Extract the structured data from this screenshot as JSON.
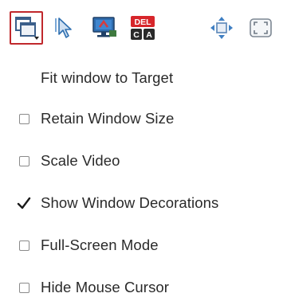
{
  "toolbar": {
    "buttons": [
      {
        "icon": "window-fit-icon",
        "active": true
      },
      {
        "icon": "mouse-pointer-icon",
        "active": false
      },
      {
        "icon": "remote-screen-icon",
        "active": false
      },
      {
        "icon": "ctrl-alt-del-icon",
        "active": false,
        "text_top": "DEL",
        "text_bottom_left": "C",
        "text_bottom_right": "A"
      },
      {
        "icon": "move-arrows-icon",
        "active": false
      },
      {
        "icon": "fullscreen-icon",
        "active": false
      }
    ],
    "accent_color": "#c0282c"
  },
  "menu": {
    "items": [
      {
        "label": "Fit window to Target",
        "type": "action"
      },
      {
        "label": "Retain Window Size",
        "type": "checkbox",
        "checked": false
      },
      {
        "label": "Scale Video",
        "type": "checkbox",
        "checked": false
      },
      {
        "label": "Show Window Decorations",
        "type": "checkbox",
        "checked": true
      },
      {
        "label": "Full-Screen Mode",
        "type": "checkbox",
        "checked": false
      },
      {
        "label": "Hide Mouse Cursor",
        "type": "checkbox",
        "checked": false
      }
    ]
  }
}
